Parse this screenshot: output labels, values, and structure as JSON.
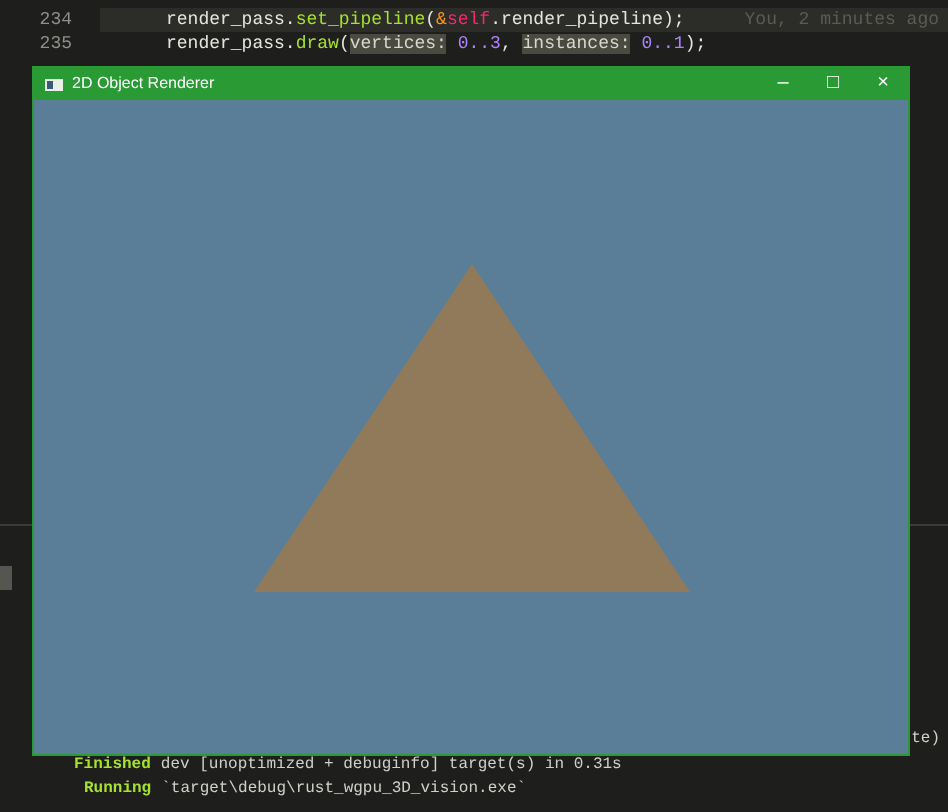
{
  "editor": {
    "lines": [
      {
        "number": "234",
        "current": true,
        "tokens": [
          {
            "text": "render_pass",
            "kind": "ident"
          },
          {
            "text": ".",
            "kind": "punct"
          },
          {
            "text": "set_pipeline",
            "kind": "fn"
          },
          {
            "text": "(",
            "kind": "punct"
          },
          {
            "text": "&",
            "kind": "op"
          },
          {
            "text": "self",
            "kind": "keyword"
          },
          {
            "text": ".render_pipeline);",
            "kind": "ident"
          }
        ],
        "blame": "You, 2 minutes ago"
      },
      {
        "number": "235",
        "current": false,
        "tokens": [
          {
            "text": "render_pass",
            "kind": "ident"
          },
          {
            "text": ".",
            "kind": "punct"
          },
          {
            "text": "draw",
            "kind": "fn"
          },
          {
            "text": "(",
            "kind": "punct"
          },
          {
            "text": "vertices:",
            "kind": "hint"
          },
          {
            "text": " 0..3",
            "kind": "number"
          },
          {
            "text": ", ",
            "kind": "punct"
          },
          {
            "text": "instances:",
            "kind": "hint"
          },
          {
            "text": " 0..1",
            "kind": "number"
          },
          {
            "text": ");",
            "kind": "punct"
          }
        ]
      }
    ]
  },
  "window": {
    "title": "2D Object Renderer",
    "controls": [
      "–",
      "□",
      "×"
    ]
  },
  "side_text": "te)",
  "terminal": {
    "lines": [
      {
        "status": "Finished",
        "message": "dev [unoptimized + debuginfo] target(s) in 0.31s"
      },
      {
        "status": "Running",
        "message": "`target\\debug\\rust_wgpu_3D_vision.exe`"
      }
    ]
  }
}
